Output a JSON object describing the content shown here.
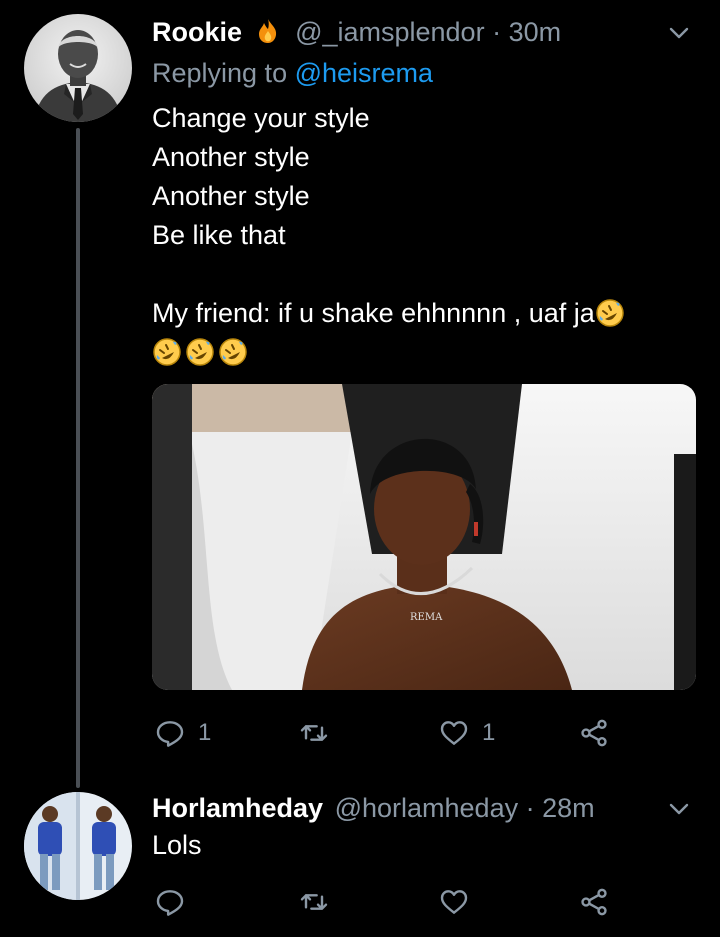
{
  "tweets": [
    {
      "name": "Rookie",
      "name_emoji": "fire-emoji",
      "handle": "@_iamsplendor",
      "separator": " · ",
      "time": "30m",
      "replying_prefix": "Replying to ",
      "replying_to": "@heisrema",
      "text_lines": [
        "Change your style",
        "Another style",
        "Another style",
        "Be like that",
        "",
        "My friend: if u shake ehhnnnn , uaf ja"
      ],
      "trailing_emoji": "rolling-on-floor-laughing-emoji",
      "emoji_row_count": 3,
      "reply_count": "1",
      "retweet_count": "",
      "like_count": "1"
    },
    {
      "name": "Horlamheday",
      "handle": "@horlamheday",
      "separator": " · ",
      "time": "28m",
      "text_lines": [
        "Lols"
      ],
      "reply_count": "",
      "retweet_count": "",
      "like_count": ""
    }
  ],
  "colors": {
    "background": "#000000",
    "muted": "#8b98a5",
    "link": "#1d9bf0",
    "thread_line": "#4a4f55"
  }
}
